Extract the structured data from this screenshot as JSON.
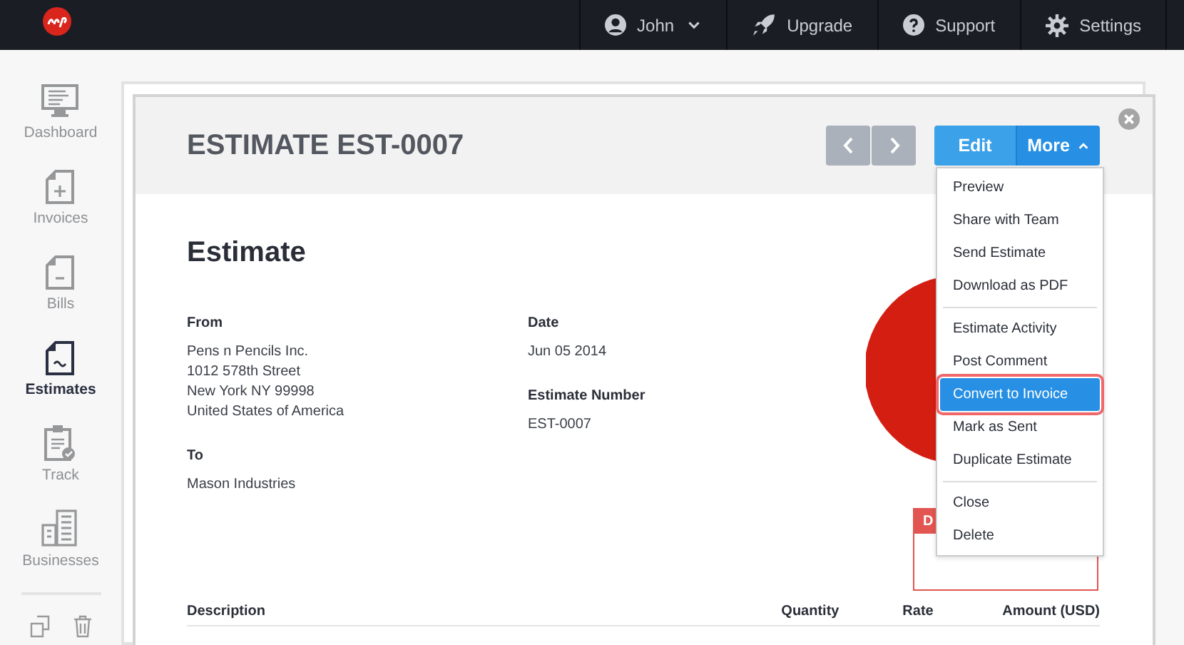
{
  "topbar": {
    "nav": [
      {
        "label": "John"
      },
      {
        "label": "Upgrade"
      },
      {
        "label": "Support"
      },
      {
        "label": "Settings"
      }
    ]
  },
  "sidebar": {
    "items": [
      {
        "label": "Dashboard",
        "selected": false
      },
      {
        "label": "Invoices",
        "selected": false
      },
      {
        "label": "Bills",
        "selected": false
      },
      {
        "label": "Estimates",
        "selected": true
      },
      {
        "label": "Track",
        "selected": false
      },
      {
        "label": "Businesses",
        "selected": false
      }
    ]
  },
  "estimate": {
    "title": "ESTIMATE EST-0007",
    "edit": "Edit",
    "more": "More",
    "menu": {
      "expanded": true,
      "groups": [
        [
          {
            "label": "Preview",
            "selected": false
          },
          {
            "label": "Share with Team",
            "selected": false
          },
          {
            "label": "Send Estimate",
            "selected": false
          },
          {
            "label": "Download as PDF",
            "selected": false
          }
        ],
        [
          {
            "label": "Estimate Activity",
            "selected": false
          },
          {
            "label": "Post Comment",
            "selected": false
          },
          {
            "label": "Convert to Invoice",
            "selected": true
          },
          {
            "label": "Mark as Sent",
            "selected": false
          },
          {
            "label": "Duplicate Estimate",
            "selected": false
          }
        ],
        [
          {
            "label": "Close",
            "selected": false
          },
          {
            "label": "Delete",
            "selected": false
          }
        ]
      ]
    },
    "document": {
      "heading": "Estimate",
      "from": {
        "label": "From",
        "lines": [
          "Pens n Pencils Inc.",
          "1012 578th Street",
          "New York NY 99998",
          "United States of America"
        ]
      },
      "to": {
        "label": "To",
        "lines": [
          "Mason Industries"
        ]
      },
      "date": {
        "label": "Date",
        "value": "Jun 05 2014"
      },
      "number": {
        "label": "Estimate Number",
        "value": "EST-0007"
      },
      "status_badge": "D",
      "columns": [
        "Description",
        "Quantity",
        "Rate",
        "Amount (USD)"
      ]
    }
  }
}
